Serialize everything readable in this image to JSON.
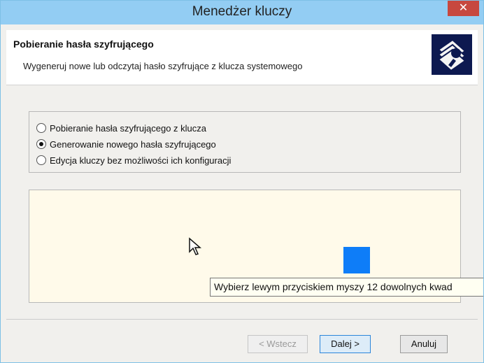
{
  "window": {
    "title": "Menedżer kluczy",
    "close_label": "✕"
  },
  "header": {
    "title": "Pobieranie hasła szyfrującego",
    "subtitle": "Wygeneruj nowe lub odczytaj hasło szyfrujące z klucza systemowego"
  },
  "options": [
    {
      "label": "Pobieranie hasła szyfrującego z klucza",
      "checked": false
    },
    {
      "label": "Generowanie nowego hasła szyfrującego",
      "checked": true
    },
    {
      "label": "Edycja kluczy bez możliwości ich konfiguracji",
      "checked": false
    }
  ],
  "tooltip": "Wybierz lewym przyciskiem myszy 12 dowolnych kwad",
  "colors": {
    "title_bar": "#93cdf3",
    "close_button": "#c7483f",
    "target_square": "#0e7df8",
    "random_area": "#fffaea"
  },
  "buttons": {
    "back": "< Wstecz",
    "next": "Dalej >",
    "cancel": "Anuluj"
  }
}
